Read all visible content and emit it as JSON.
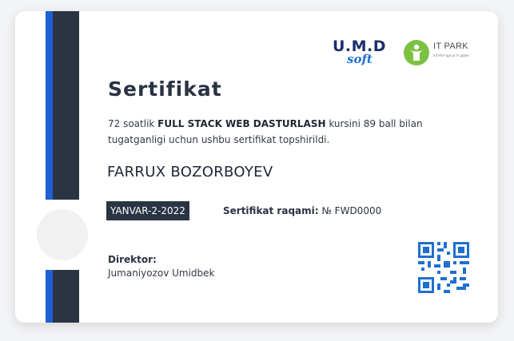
{
  "logos": {
    "umd_main": "U.M.D",
    "umd_sub": "soft",
    "itpark_name": "IT PARK",
    "itpark_tagline": "START-ups & IT globe"
  },
  "certificate": {
    "title": "Sertifikat",
    "desc_prefix": "72 soatlik ",
    "course": "FULL STACK WEB DASTURLASH",
    "desc_suffix": " kursini 89 ball bilan tugatganligi uchun ushbu sertifikat topshirildi.",
    "recipient": "FARRUX BOZORBOYEV",
    "date": "YANVAR-2-2022",
    "number_label": "Sertifikat raqami:",
    "number_value": " № FWD0000",
    "director_label": "Direktor:",
    "director_name": "Jumaniyozov Umidbek"
  },
  "colors": {
    "stripe_dark": "#2b3443",
    "stripe_accent": "#1f5fd1",
    "qr": "#1f6fd1",
    "itpark_green": "#7dc142"
  },
  "icons": {
    "qr": "qr-code-icon",
    "itpark": "itpark-logo-icon"
  }
}
